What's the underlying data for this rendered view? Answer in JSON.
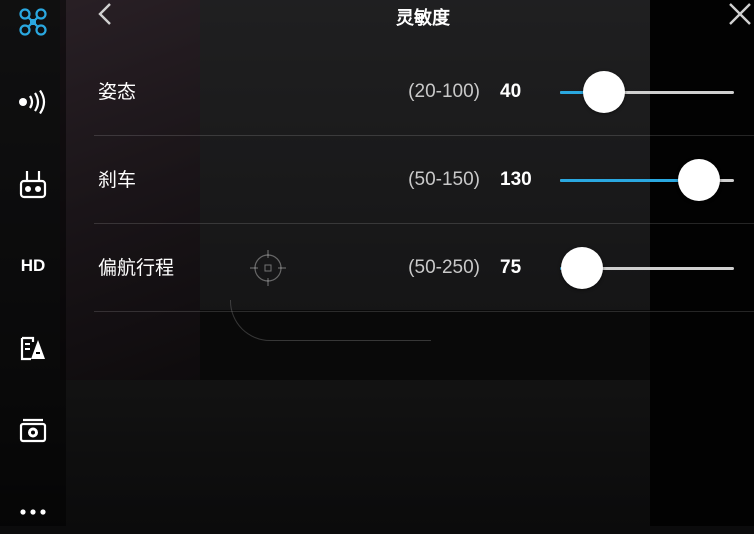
{
  "header": {
    "title": "灵敏度"
  },
  "sidebar": {
    "items": [
      {
        "icon": "aircraft-icon",
        "active": true
      },
      {
        "icon": "signal-icon"
      },
      {
        "icon": "remote-controller-icon"
      },
      {
        "icon": "hd-icon",
        "label": "HD"
      },
      {
        "icon": "battery-icon"
      },
      {
        "icon": "camera-icon"
      },
      {
        "icon": "more-icon"
      }
    ]
  },
  "sensitivity": [
    {
      "label": "姿态",
      "range": "(20-100)",
      "value": "40",
      "min": 20,
      "max": 100,
      "current": 40
    },
    {
      "label": "刹车",
      "range": "(50-150)",
      "value": "130",
      "min": 50,
      "max": 150,
      "current": 130
    },
    {
      "label": "偏航行程",
      "range": "(50-250)",
      "value": "75",
      "min": 50,
      "max": 250,
      "current": 75
    }
  ],
  "colors": {
    "accent": "#2aa8e0",
    "track": "#cfcfcf",
    "thumb": "#ffffff"
  }
}
